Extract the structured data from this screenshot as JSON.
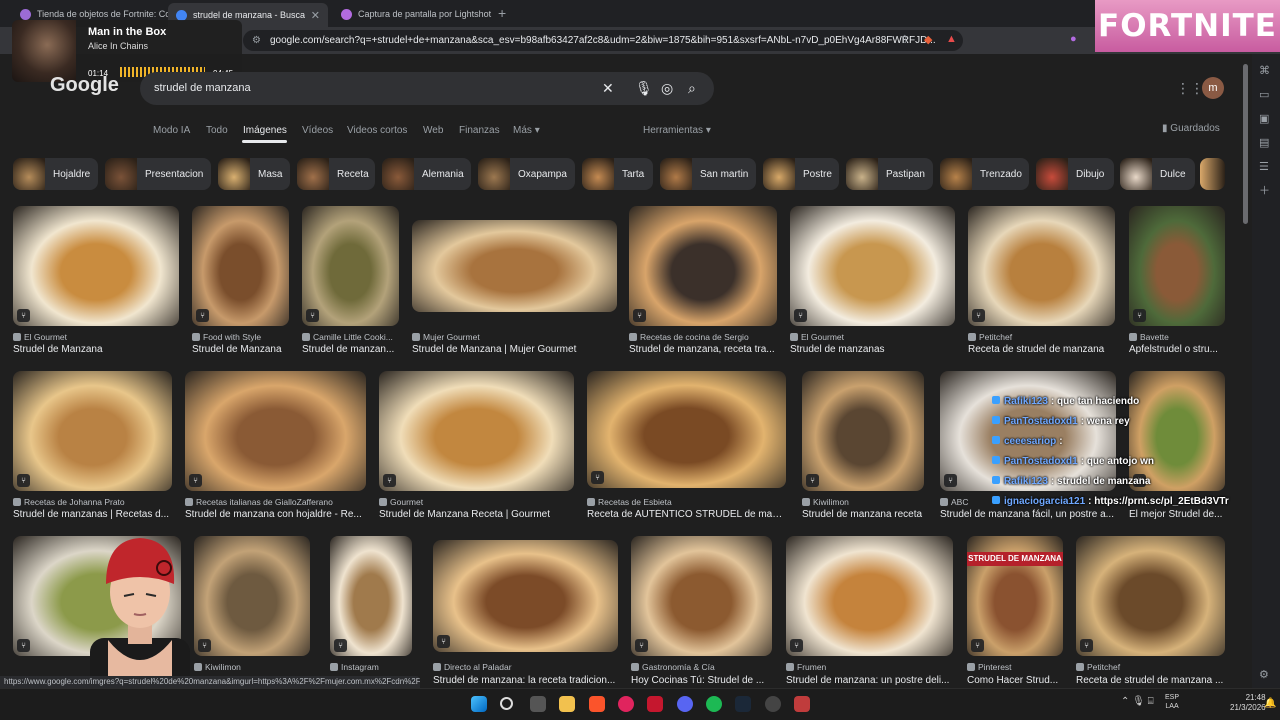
{
  "browser": {
    "tabs": [
      {
        "label": "Tienda de objetos de Fortnite: Conte",
        "fav": "#9b6bd6",
        "active": false
      },
      {
        "label": "strudel de manzana - Buscar con",
        "fav": "#4285f4",
        "active": true
      },
      {
        "label": "Captura de pantalla por Lightshot",
        "fav": "#b26be0",
        "active": false
      }
    ],
    "new_tab": "+",
    "url": "google.com/search?q=+strudel+de+manzana&sca_esv=b98afb63427af2c8&udm=2&biw=1875&bih=951&sxsrf=ANbL-n7vD_p0EhVg4Ar88FWRFJD..."
  },
  "media": {
    "title": "Man in the Box",
    "artist": "Alice In Chains",
    "current": "01:14",
    "total": "04:45"
  },
  "fortnite_banner": "FORTNITE",
  "google": {
    "logo": "Google",
    "query": "strudel de manzana",
    "avatar_letter": "m"
  },
  "nav": {
    "items": [
      "Modo IA",
      "Todo",
      "Imágenes",
      "Vídeos",
      "Videos cortos",
      "Web",
      "Finanzas",
      "Más"
    ],
    "active": "Imágenes",
    "tools": "Herramientas",
    "saved": "Guardados"
  },
  "chips": [
    {
      "label": "Hojaldre",
      "color": "#b58c5a"
    },
    {
      "label": "Presentacion",
      "color": "#7a5238"
    },
    {
      "label": "Masa",
      "color": "#d9b070"
    },
    {
      "label": "Receta",
      "color": "#a0704a"
    },
    {
      "label": "Alemania",
      "color": "#8a5a3a"
    },
    {
      "label": "Oxapampa",
      "color": "#9c7850"
    },
    {
      "label": "Tarta",
      "color": "#c48a52"
    },
    {
      "label": "San martin",
      "color": "#b07a48"
    },
    {
      "label": "Postre",
      "color": "#d7a868"
    },
    {
      "label": "Pastipan",
      "color": "#c9b28a"
    },
    {
      "label": "Trenzado",
      "color": "#b7824a"
    },
    {
      "label": "Dibujo",
      "color": "#c74b3b"
    },
    {
      "label": "Dulce",
      "color": "#e8d8c8"
    }
  ],
  "results": [
    {
      "source": "El Gourmet",
      "title": "Strudel de Manzana",
      "c1": "#f1e6cf",
      "c2": "#c98c3f"
    },
    {
      "source": "Food with Style",
      "title": "Strudel de Manzana",
      "c1": "#c79a6b",
      "c2": "#7a4e2c"
    },
    {
      "source": "Camille Little Cooki...",
      "title": "Strudel de manzan...",
      "c1": "#b3a27a",
      "c2": "#6f6a3a"
    },
    {
      "source": "Mujer Gourmet",
      "title": "Strudel de Manzana | Mujer Gourmet",
      "c1": "#e3c89c",
      "c2": "#a8733e",
      "recipe": "Receta"
    },
    {
      "source": "Recetas de cocina de Sergio",
      "title": "Strudel de manzana, receta tra...",
      "c1": "#d8a46a",
      "c2": "#3b302a"
    },
    {
      "source": "El Gourmet",
      "title": "Strudel de manzanas",
      "c1": "#f3ecdf",
      "c2": "#c8974f"
    },
    {
      "source": "Petitchef",
      "title": "Receta de strudel de manzana",
      "c1": "#e7d7b9",
      "c2": "#b8803e"
    },
    {
      "source": "Bavette",
      "title": "Apfelstrudel o stru...",
      "c1": "#4e6a3a",
      "c2": "#8a5a38"
    },
    {
      "source": "Recetas de Johanna Prato",
      "title": "Strudel de manzanas | Recetas d...",
      "c1": "#e8c68a",
      "c2": "#b98244"
    },
    {
      "source": "Recetas italianas de GialloZafferano",
      "title": "Strudel de manzana con hojaldre - Re...",
      "c1": "#d9a66b",
      "c2": "#8a5a35"
    },
    {
      "source": "Gourmet",
      "title": "Strudel de Manzana Receta | Gourmet",
      "c1": "#f0ddb8",
      "c2": "#c2873f"
    },
    {
      "source": "Recetas de Esbieta",
      "title": "Receta de AUTÉNTICO STRUDEL de man...",
      "c1": "#e2b36e",
      "c2": "#7a4a24"
    },
    {
      "source": "Kiwilimon",
      "title": "Strudel de manzana receta",
      "c1": "#c9a16e",
      "c2": "#5a4632"
    },
    {
      "source": "ABC",
      "title": "Strudel de manzana fácil, un postre a...",
      "c1": "#e6e1da",
      "c2": "#9a7f62"
    },
    {
      "source": "",
      "title": "El mejor Strudel de...",
      "c1": "#cfa064",
      "c2": "#6f8c3a"
    },
    {
      "source": "",
      "title": "",
      "c1": "#dcd6c8",
      "c2": "#8c9a4a"
    },
    {
      "source": "Kiwilimon",
      "title": "",
      "c1": "#c2a277",
      "c2": "#6e5a40"
    },
    {
      "source": "Instagram",
      "title": "",
      "c1": "#efe3cf",
      "c2": "#a07a4c"
    },
    {
      "source": "Directo al Paladar",
      "title": "Strudel de manzana: la receta tradicion...",
      "c1": "#e8c18a",
      "c2": "#7c4b28"
    },
    {
      "source": "Gastronomía & Cía",
      "title": "Hoy Cocinas Tú: Strudel de ...",
      "c1": "#e2c49a",
      "c2": "#8c5a30"
    },
    {
      "source": "Frumen",
      "title": "Strudel de manzana: un postre deli...",
      "c1": "#f0e4d0",
      "c2": "#c5833c"
    },
    {
      "source": "Pinterest",
      "title": "Como Hacer Strud...",
      "c1": "#caa06a",
      "c2": "#8a5230",
      "banner": "STRUDEL DE MANZANA"
    },
    {
      "source": "Petitchef",
      "title": "Receta de strudel de manzana ...",
      "c1": "#d6b27a",
      "c2": "#6b4a2a"
    }
  ],
  "chat": [
    {
      "user": "Rafiki123",
      "text": ": que tan haciendo"
    },
    {
      "user": "PanTostadoxd1",
      "text": ": wena rey"
    },
    {
      "user": "ceeesariop",
      "text": ":"
    },
    {
      "user": "PanTostadoxd1",
      "text": ": que antojo wn"
    },
    {
      "user": "Rafiki123",
      "text": ": strudel de manzana"
    },
    {
      "user": "ignaciogarcia121",
      "text": ": https://prnt.sc/pl_2EtBd3VTr"
    }
  ],
  "status_url": "https://www.google.com/imgres?q=strudel%20de%20manzana&imgurl=https%3A%2F%2Fmujer.com.mx%2Fcdn%2Ffeci...",
  "clock": {
    "time": "21:48",
    "date": "21/3/2026"
  },
  "lang": {
    "a": "ESP",
    "b": "LAA"
  }
}
